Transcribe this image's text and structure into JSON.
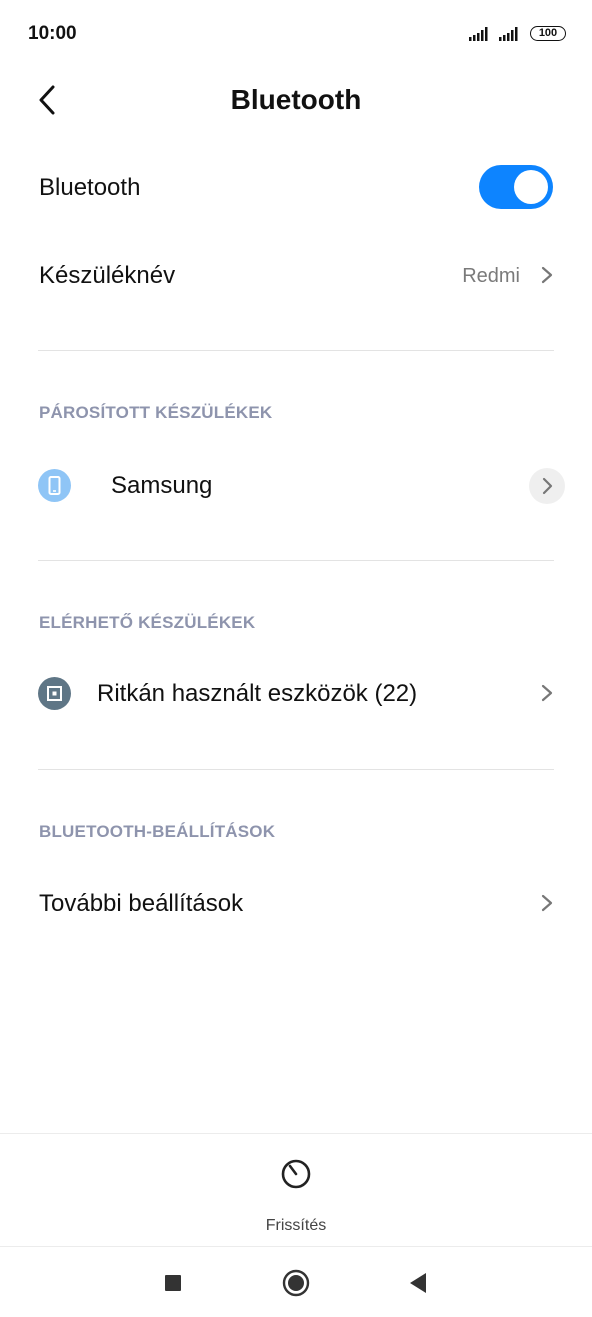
{
  "status_bar": {
    "time": "10:00",
    "battery": "100"
  },
  "header": {
    "title": "Bluetooth"
  },
  "settings": {
    "bluetooth_label": "Bluetooth",
    "bluetooth_on": true,
    "device_name_label": "Készüléknév",
    "device_name_value": "Redmi"
  },
  "paired": {
    "header": "PÁROSÍTOTT KÉSZÜLÉKEK",
    "devices": [
      {
        "name": "Samsung",
        "icon": "phone-icon"
      }
    ]
  },
  "available": {
    "header": "ELÉRHETŐ KÉSZÜLÉKEK",
    "items": [
      {
        "label": "Ritkán használt eszközök (22)",
        "icon": "device-group-icon"
      }
    ]
  },
  "bt_settings": {
    "header": "BLUETOOTH-BEÁLLÍTÁSOK",
    "more_label": "További beállítások"
  },
  "bottom_action": {
    "label": "Frissítés",
    "icon": "refresh-icon"
  },
  "colors": {
    "accent": "#0d84ff",
    "section_header": "#8e94ad",
    "secondary_text": "#7a7a7a"
  }
}
